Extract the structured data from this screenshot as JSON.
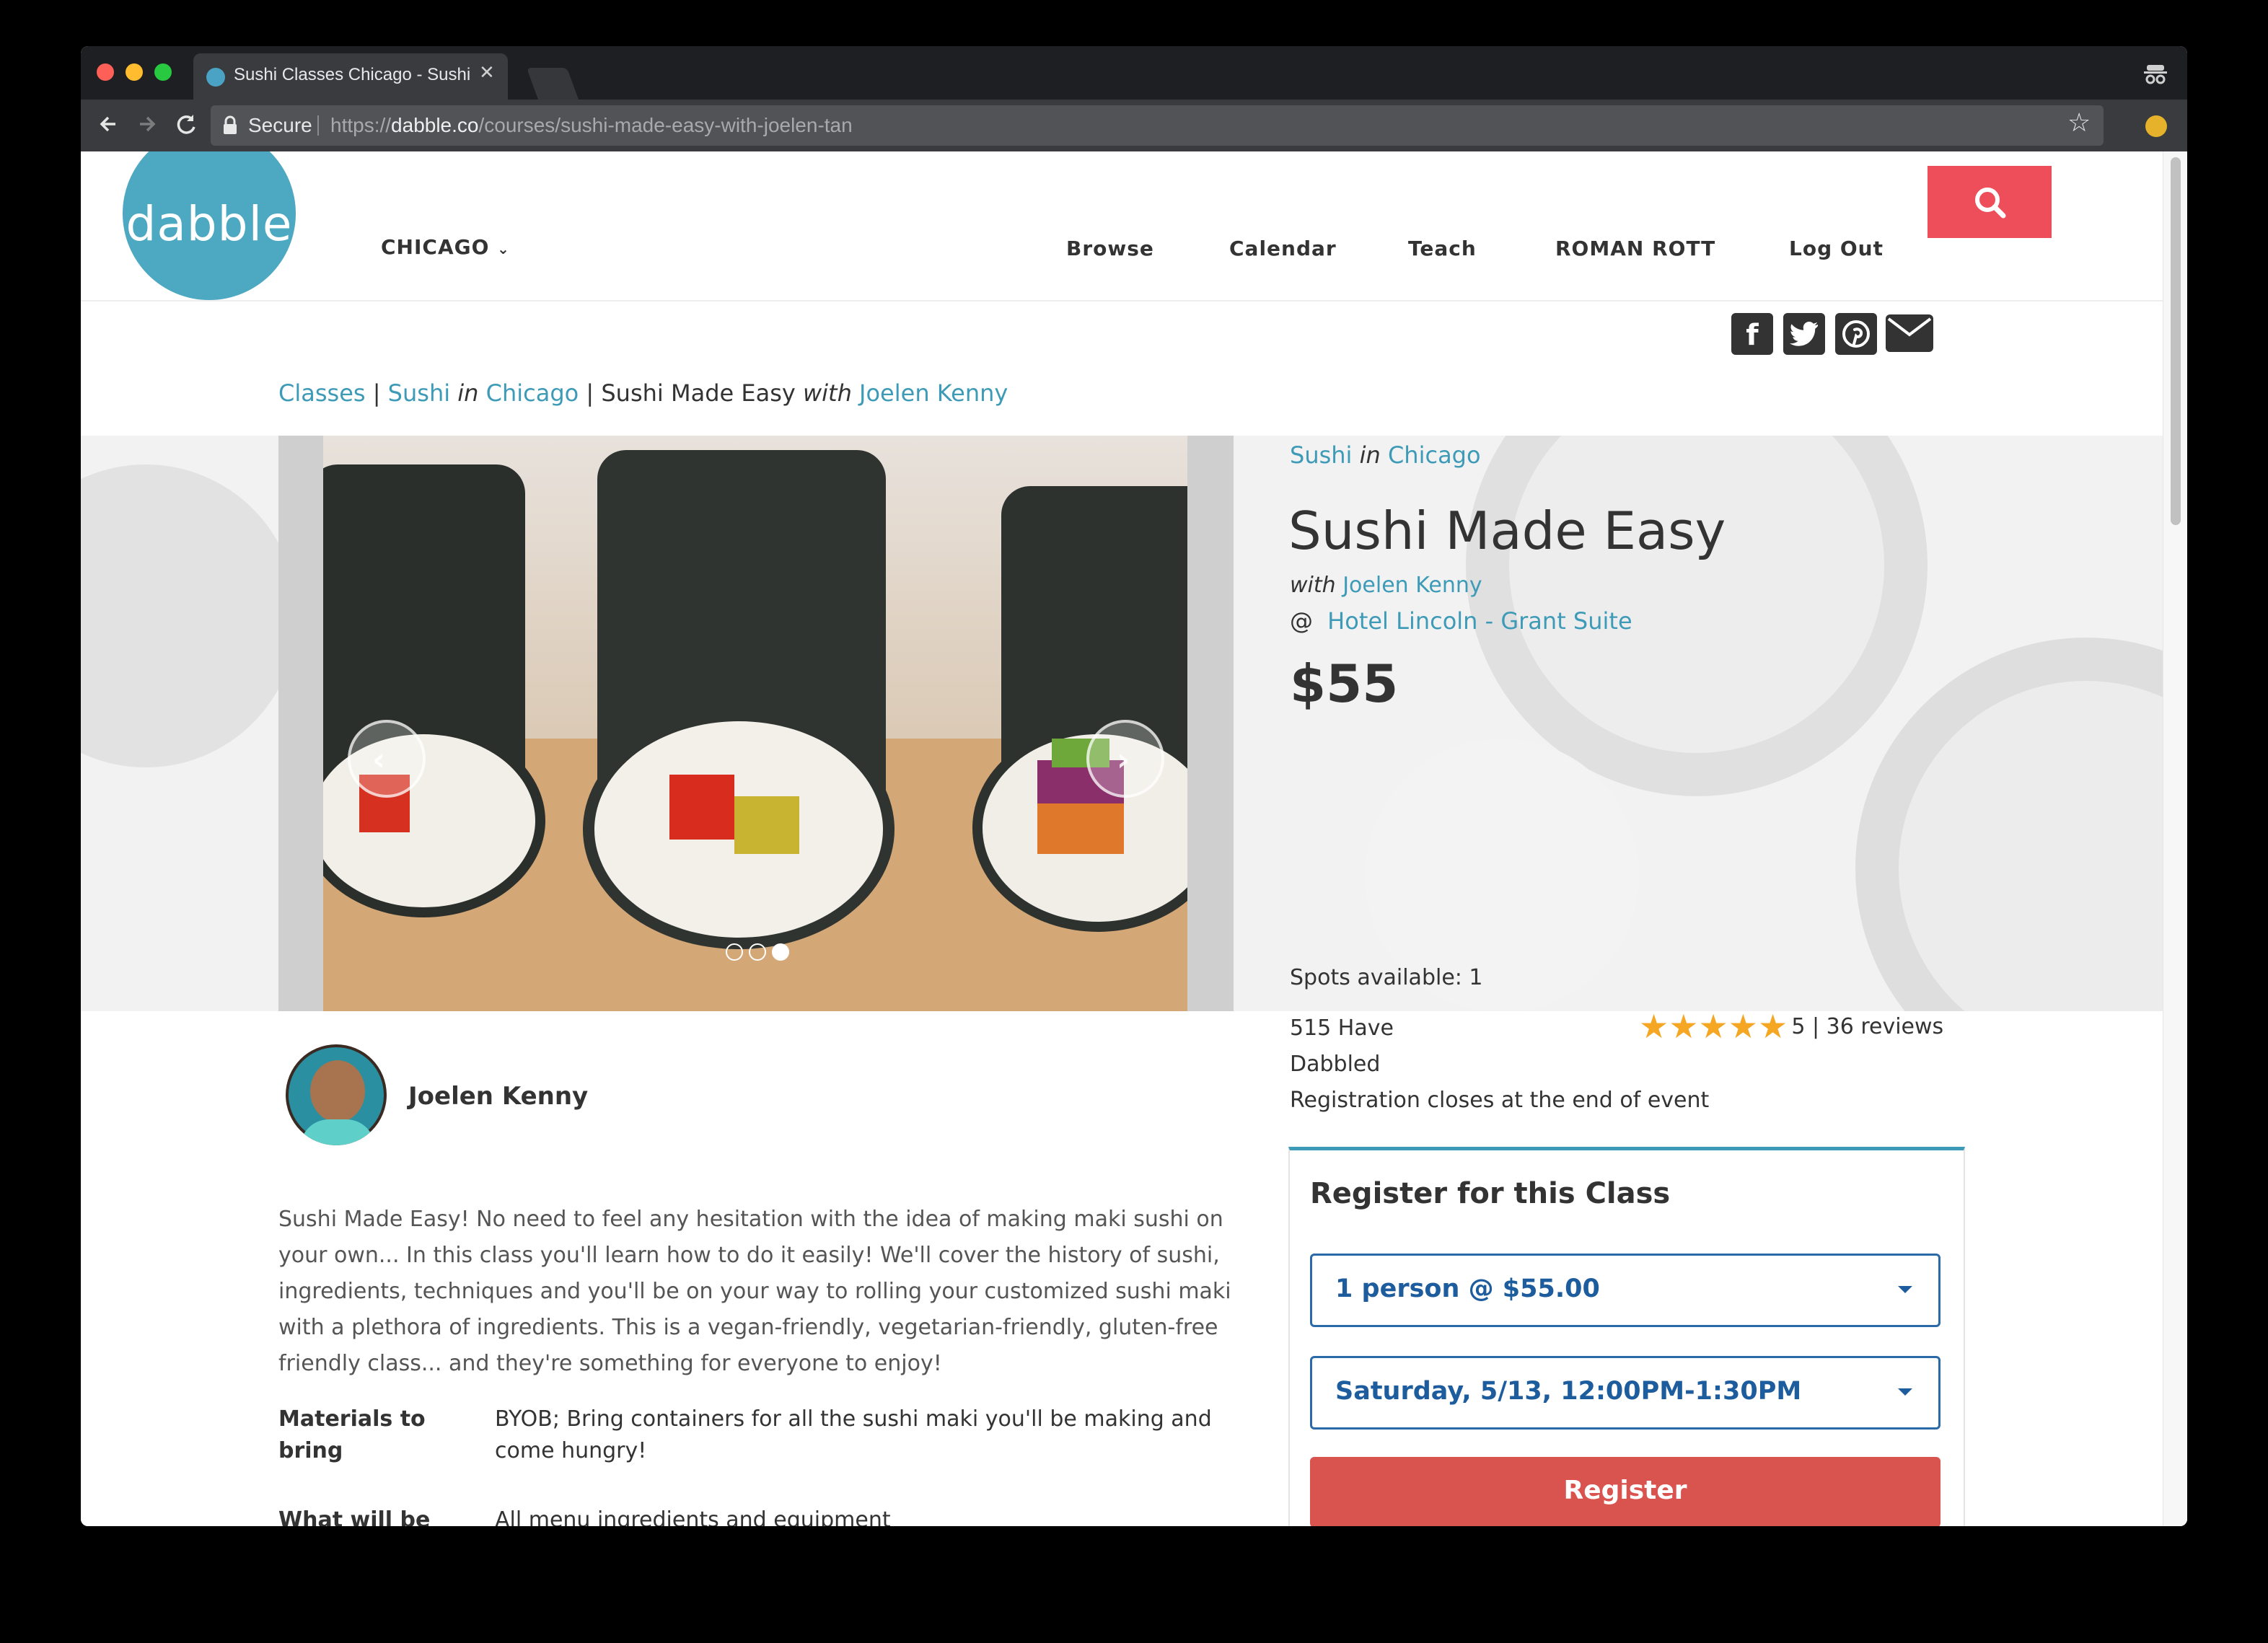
{
  "browser": {
    "tab_title": "Sushi Classes Chicago - Sushi",
    "secure_label": "Secure",
    "url_scheme": "https://",
    "url_host": "dabble.co",
    "url_path": "/courses/sushi-made-easy-with-joelen-tan"
  },
  "header": {
    "logo_text": "dabble",
    "city": "CHICAGO",
    "nav": [
      "Browse",
      "Calendar",
      "Teach",
      "ROMAN ROTT",
      "Log Out"
    ]
  },
  "breadcrumb": {
    "classes": "Classes",
    "sep1": "|",
    "sushi": "Sushi",
    "in": "in",
    "chicago": "Chicago",
    "sep2": "|",
    "current": "Sushi Made Easy",
    "with": "with",
    "instructor": "Joelen Kenny"
  },
  "class_info": {
    "category": "Sushi",
    "in": "in",
    "city": "Chicago",
    "title": "Sushi Made Easy",
    "with": "with",
    "instructor": "Joelen Kenny",
    "at": "@",
    "venue": "Hotel Lincoln - Grant Suite",
    "price": "$55",
    "spots": "Spots available: 1",
    "have_dabbled_1": "515 Have",
    "have_dabbled_2": "Dabbled",
    "rating": 5,
    "rating_text": "5 | 36 reviews",
    "registration_note": "Registration closes at the end of event"
  },
  "carousel": {
    "slide_count": 3,
    "active_slide": 3
  },
  "instructor_block": {
    "name": "Joelen Kenny"
  },
  "description": "Sushi Made Easy! No need to feel any hesitation with the idea of making maki sushi on your own... In this class you'll learn how to do it easily! We'll cover the history of sushi, ingredients, techniques and you'll be on your way to rolling your customized sushi maki with a plethora of ingredients. This is a vegan-friendly, vegetarian-friendly, gluten-free friendly class... and they're something for everyone to enjoy!",
  "details": [
    {
      "label": "Materials to bring",
      "value": "BYOB; Bring containers for all the sushi maki you'll be making and come hungry!"
    },
    {
      "label": "What will be provided",
      "value": "All menu ingredients and equipment"
    }
  ],
  "register": {
    "heading": "Register for this Class",
    "quantity_selected": "1 person @ $55.00",
    "date_selected": "Saturday, 5/13, 12:00PM-1:30PM",
    "button_label": "Register"
  },
  "colors": {
    "accent_blue": "#3e9bb8",
    "search_red": "#ee4e59",
    "register_red": "#d9534f",
    "select_blue": "#1d5c9d",
    "star_gold": "#f5a623"
  },
  "icons": [
    "back-icon",
    "forward-icon",
    "reload-icon",
    "lock-icon",
    "bookmark-star-icon",
    "extension-icon",
    "incognito-icon",
    "search-icon",
    "facebook-icon",
    "twitter-icon",
    "pinterest-icon",
    "email-icon",
    "chevron-left-icon",
    "chevron-right-icon",
    "chevron-down-icon",
    "star-icon"
  ]
}
